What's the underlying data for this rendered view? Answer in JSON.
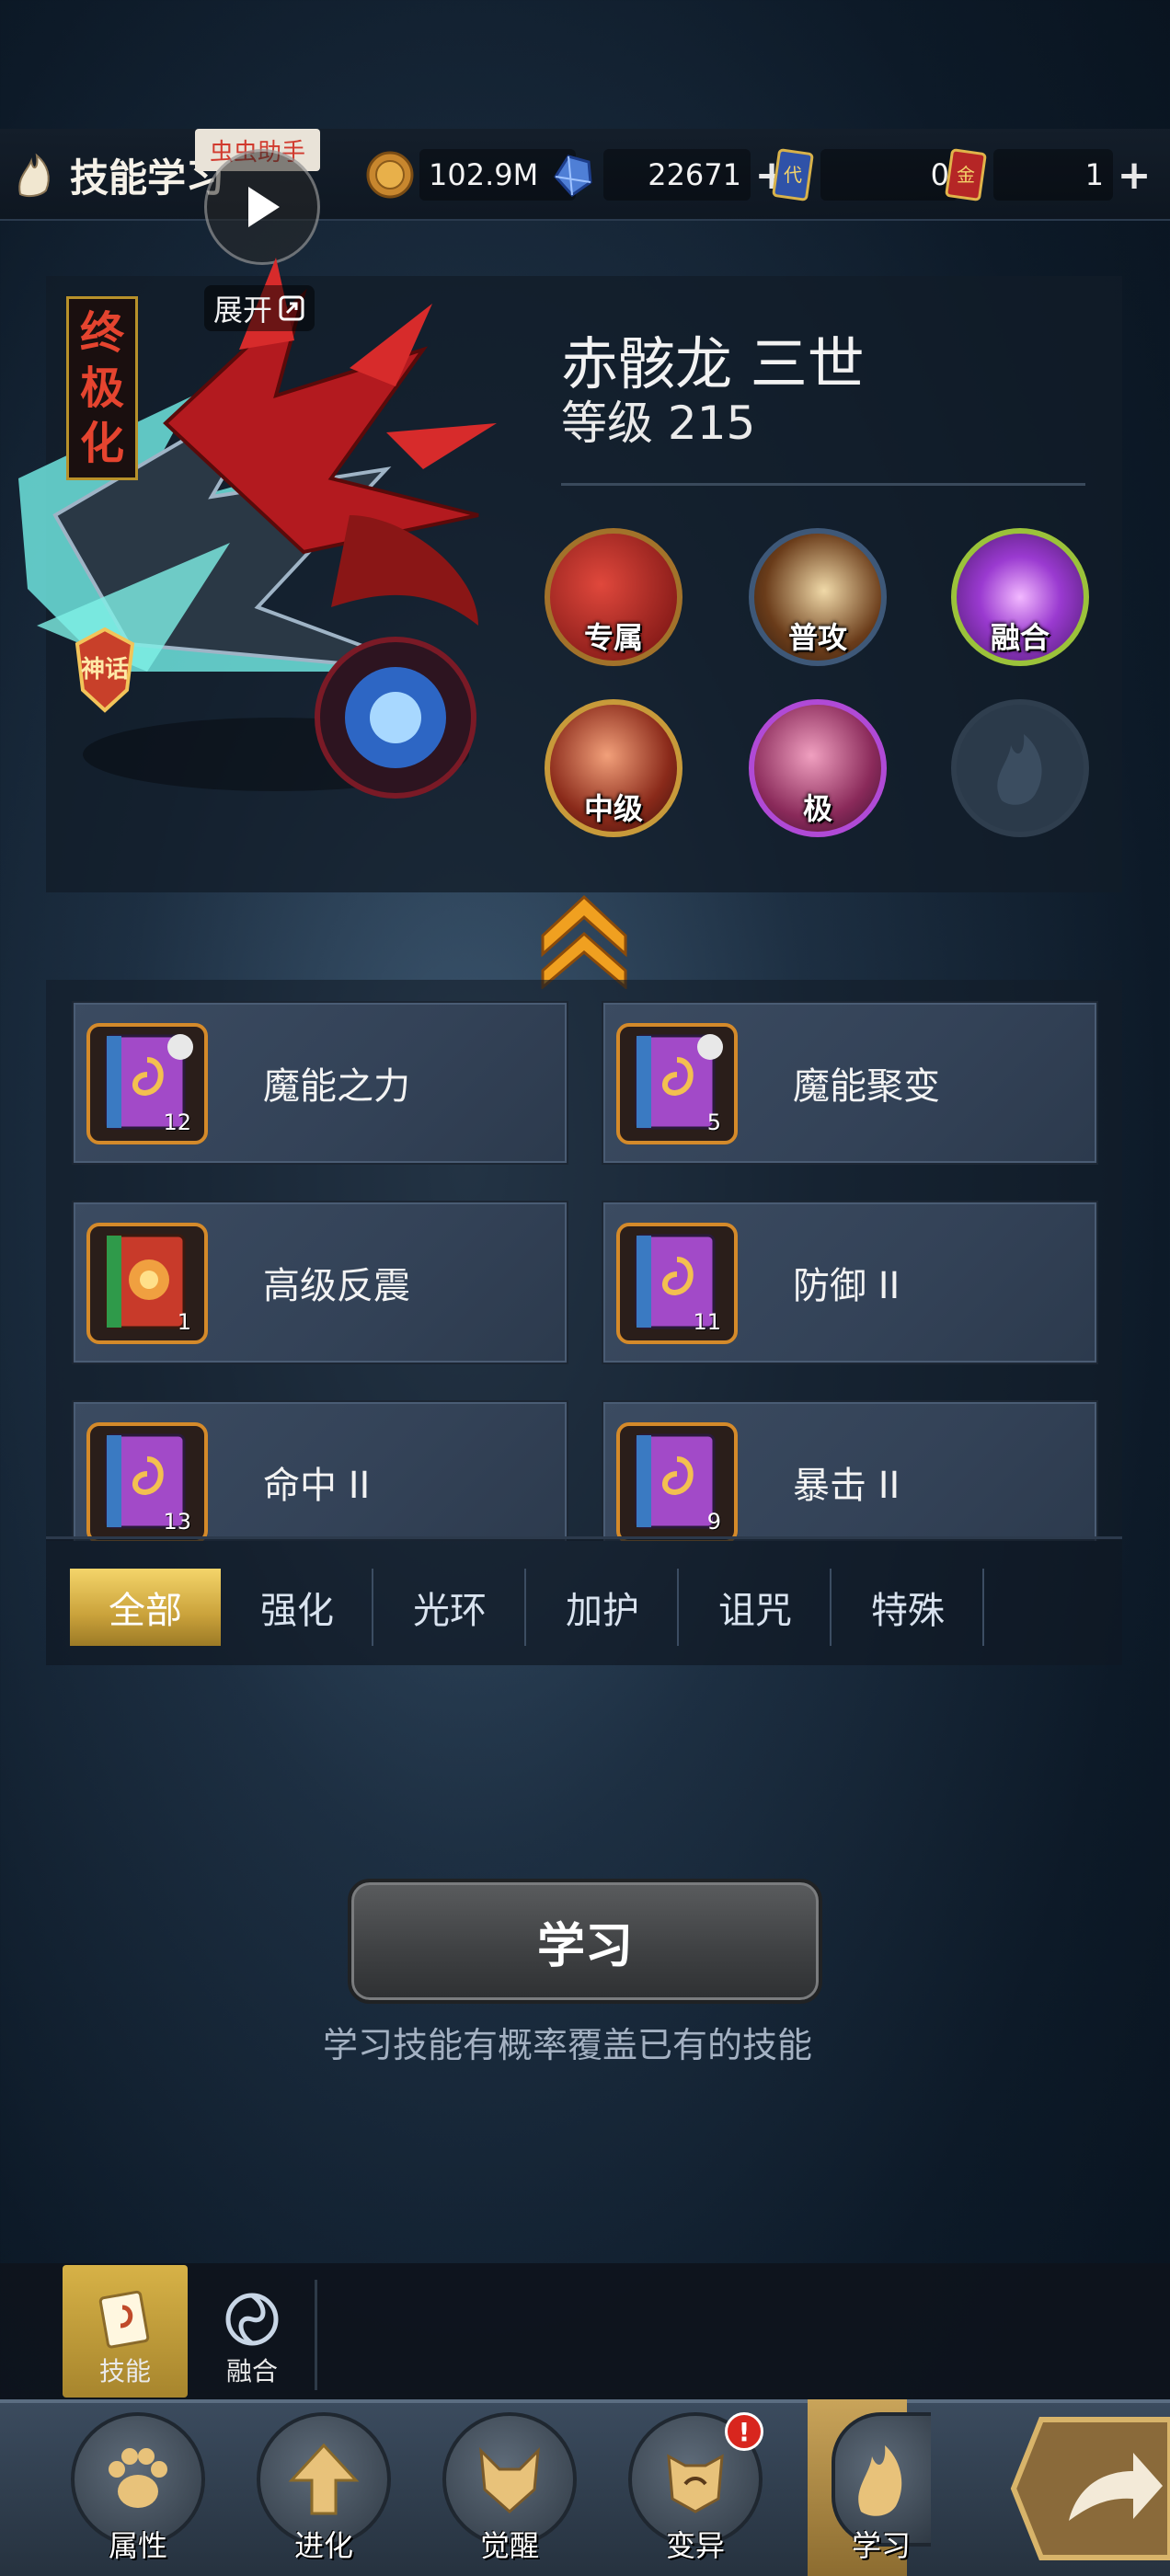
{
  "header": {
    "title": "技能学习",
    "assist_badge": "虫虫助手"
  },
  "resources": {
    "gold": "102.9M",
    "gems": "22671",
    "ticket_a": "0",
    "ticket_b": "1"
  },
  "hero": {
    "expand_label": "展开",
    "ultimate_tag": [
      "终",
      "极",
      "化"
    ],
    "myth_badge": "神话",
    "name": "赤骸龙 三世",
    "level": "等级 215"
  },
  "hero_skills": [
    {
      "label": "专属",
      "color": "#9b1a1a"
    },
    {
      "label": "普攻",
      "color": "#6a4a2a"
    },
    {
      "label": "融合",
      "color": "#8a2fae"
    },
    {
      "label": "中级",
      "color": "#7a2418"
    },
    {
      "label": "极",
      "color": "#7e3a9a"
    },
    {
      "label": "",
      "color": "#2c3b4a"
    }
  ],
  "skill_books": [
    {
      "name": "魔能之力",
      "count": "12",
      "book": "purple"
    },
    {
      "name": "魔能聚变",
      "count": "5",
      "book": "purple"
    },
    {
      "name": "高级反震",
      "count": "1",
      "book": "red"
    },
    {
      "name": "防御 II",
      "count": "11",
      "book": "purple"
    },
    {
      "name": "命中 II",
      "count": "13",
      "book": "purple"
    },
    {
      "name": "暴击 II",
      "count": "9",
      "book": "purple"
    }
  ],
  "filter_tabs": [
    "全部",
    "强化",
    "光环",
    "加护",
    "诅咒",
    "特殊"
  ],
  "learn": {
    "button": "学习",
    "hint": "学习技能有概率覆盖已有的技能"
  },
  "sub_tabs": [
    "技能",
    "融合"
  ],
  "nav": [
    "属性",
    "进化",
    "觉醒",
    "变异",
    "学习"
  ],
  "nav_alert": "!"
}
